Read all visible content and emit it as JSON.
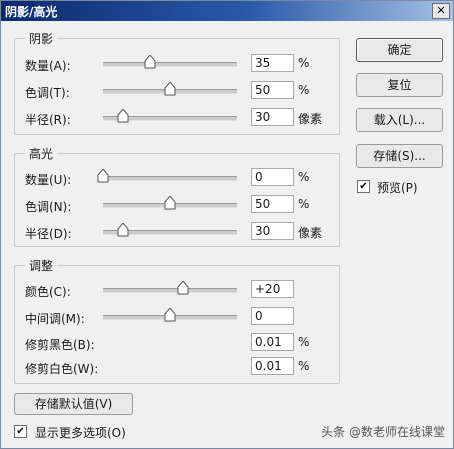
{
  "window": {
    "title": "阴影/高光",
    "close_glyph": "✕"
  },
  "shadows": {
    "legend": "阴影",
    "rows": [
      {
        "label": "数量(A):",
        "value": "35",
        "unit": "%",
        "slider_pct": 35
      },
      {
        "label": "色调(T):",
        "value": "50",
        "unit": "%",
        "slider_pct": 50
      },
      {
        "label": "半径(R):",
        "value": "30",
        "unit": "像素",
        "slider_pct": 15
      }
    ]
  },
  "highlights": {
    "legend": "高光",
    "rows": [
      {
        "label": "数量(U):",
        "value": "0",
        "unit": "%",
        "slider_pct": 0
      },
      {
        "label": "色调(N):",
        "value": "50",
        "unit": "%",
        "slider_pct": 50
      },
      {
        "label": "半径(D):",
        "value": "30",
        "unit": "像素",
        "slider_pct": 15
      }
    ]
  },
  "adjustments": {
    "legend": "调整",
    "color": {
      "label": "颜色(C):",
      "value": "+20",
      "slider_pct": 60
    },
    "midtone": {
      "label": "中间调(M):",
      "value": "0",
      "slider_pct": 50
    },
    "clip_black": {
      "label": "修剪黑色(B):",
      "value": "0.01",
      "unit": "%"
    },
    "clip_white": {
      "label": "修剪白色(W):",
      "value": "0.01",
      "unit": "%"
    }
  },
  "buttons": {
    "ok": "确定",
    "reset": "复位",
    "load": "载入(L)...",
    "save": "存储(S)...",
    "save_defaults": "存储默认值(V)"
  },
  "preview": {
    "label": "预览(P)",
    "checked": true,
    "check_glyph": "✔"
  },
  "more_options": {
    "label": "显示更多选项(O)",
    "checked": true,
    "check_glyph": "✔"
  },
  "watermark": "头条 @数老师在线课堂",
  "colors": {
    "dialog_bg": "#f0f0f0",
    "title_bar": "#0b2a6f"
  }
}
